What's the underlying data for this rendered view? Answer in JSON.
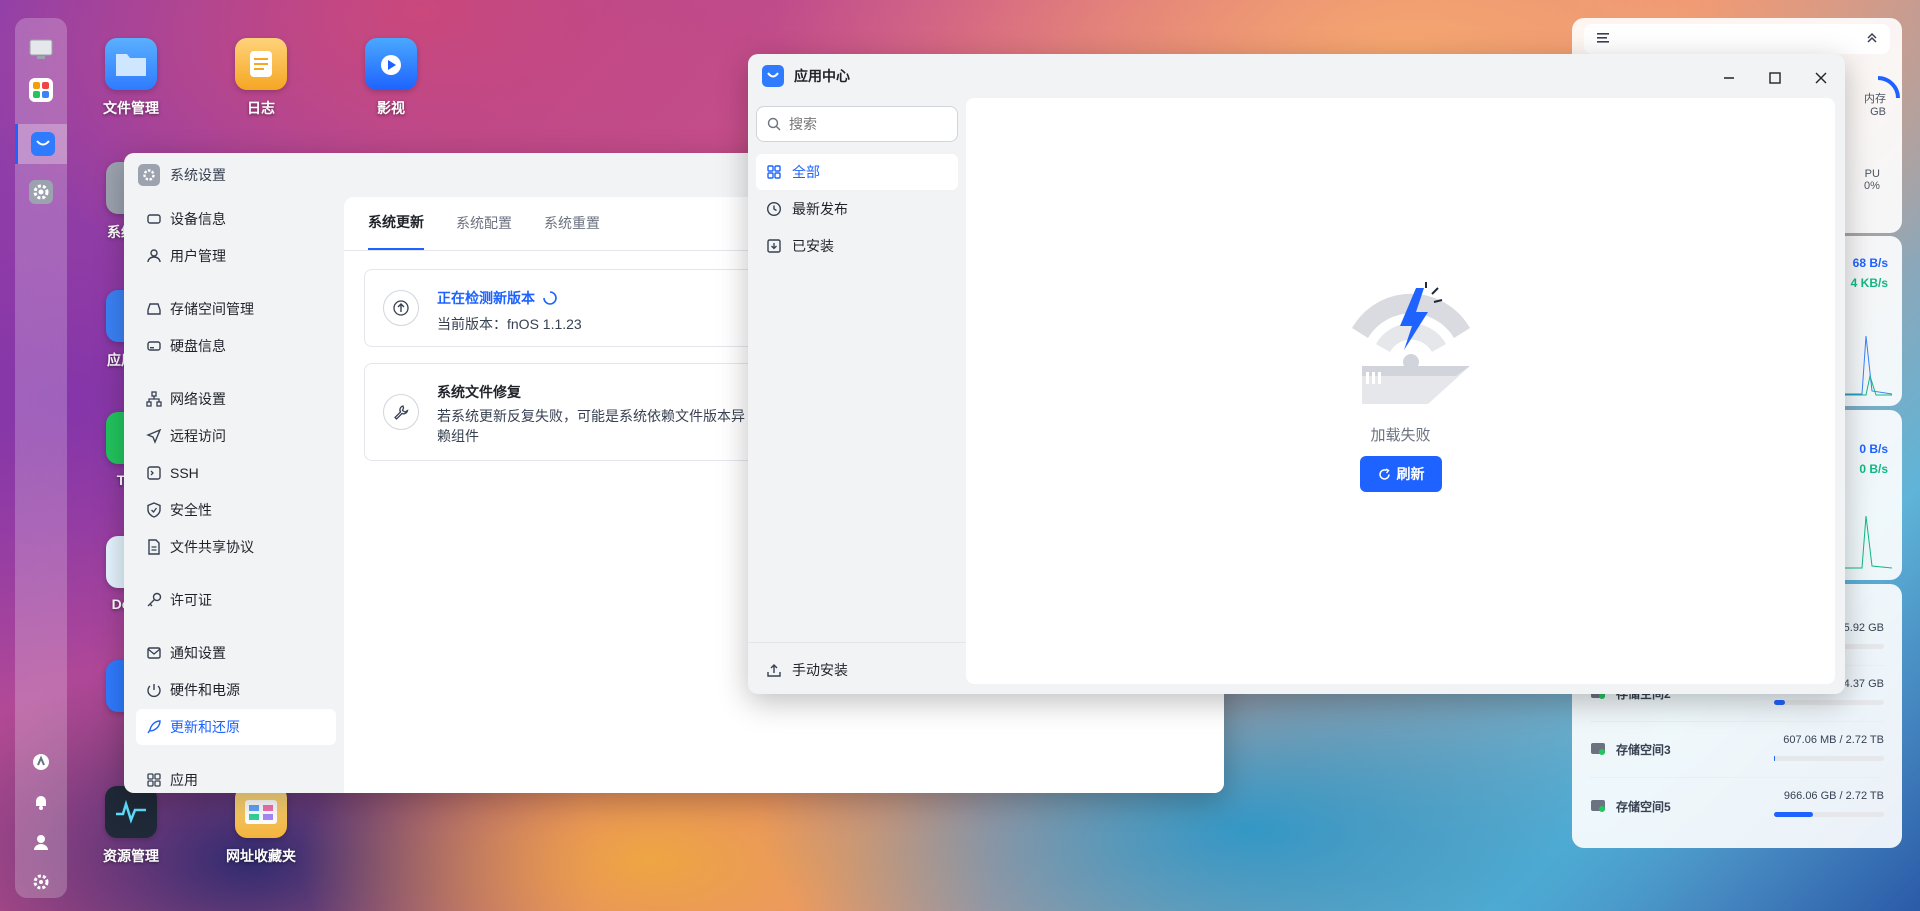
{
  "desktop": {
    "icons": [
      {
        "label": "文件管理"
      },
      {
        "label": "日志"
      },
      {
        "label": "影视"
      },
      {
        "label": "资源管理"
      },
      {
        "label": "网址收藏夹"
      },
      {
        "label": "系统"
      },
      {
        "label": "应用"
      },
      {
        "label": "Do"
      },
      {
        "label": "T"
      }
    ]
  },
  "settings": {
    "title": "系统设置",
    "nav": [
      {
        "label": "设备信息"
      },
      {
        "label": "用户管理"
      },
      {
        "label": "存储空间管理"
      },
      {
        "label": "硬盘信息"
      },
      {
        "label": "网络设置"
      },
      {
        "label": "远程访问"
      },
      {
        "label": "SSH"
      },
      {
        "label": "安全性"
      },
      {
        "label": "文件共享协议"
      },
      {
        "label": "许可证"
      },
      {
        "label": "通知设置"
      },
      {
        "label": "硬件和电源"
      },
      {
        "label": "更新和还原"
      },
      {
        "label": "应用"
      }
    ],
    "tabs": [
      {
        "label": "系统更新"
      },
      {
        "label": "系统配置"
      },
      {
        "label": "系统重置"
      }
    ],
    "update_card": {
      "title": "正在检测新版本",
      "version_label": "当前版本：",
      "version": "fnOS 1.1.23"
    },
    "repair_card": {
      "title": "系统文件修复",
      "desc_line1": "若系统更新反复失败，可能是系统依赖文件版本异",
      "desc_line2": "赖组件"
    }
  },
  "appcenter": {
    "title": "应用中心",
    "search_placeholder": "搜索",
    "nav": [
      {
        "label": "全部"
      },
      {
        "label": "最新发布"
      },
      {
        "label": "已安装"
      }
    ],
    "manual_install": "手动安装",
    "empty_message": "加载失败",
    "refresh_label": "刷新"
  },
  "widgets": {
    "memory_label": "内存",
    "memory_value": "GB",
    "cpu_label": "PU",
    "cpu_value": "0%",
    "net1_up": "68 B/s",
    "net1_down": "4 KB/s",
    "net2_up": "0 B/s",
    "net2_down": "0 B/s",
    "storage": [
      {
        "name": "",
        "value": "5.92 GB",
        "fill": 0.05
      },
      {
        "name": "存储空间2",
        "value": "4.37 GB",
        "fill": 0.1
      },
      {
        "name": "存储空间3",
        "value": "607.06 MB / 2.72 TB",
        "fill": 0.01
      },
      {
        "name": "存储空间5",
        "value": "966.06 GB / 2.72 TB",
        "fill": 0.35
      }
    ]
  },
  "colors": {
    "accent": "#1e63ff"
  }
}
